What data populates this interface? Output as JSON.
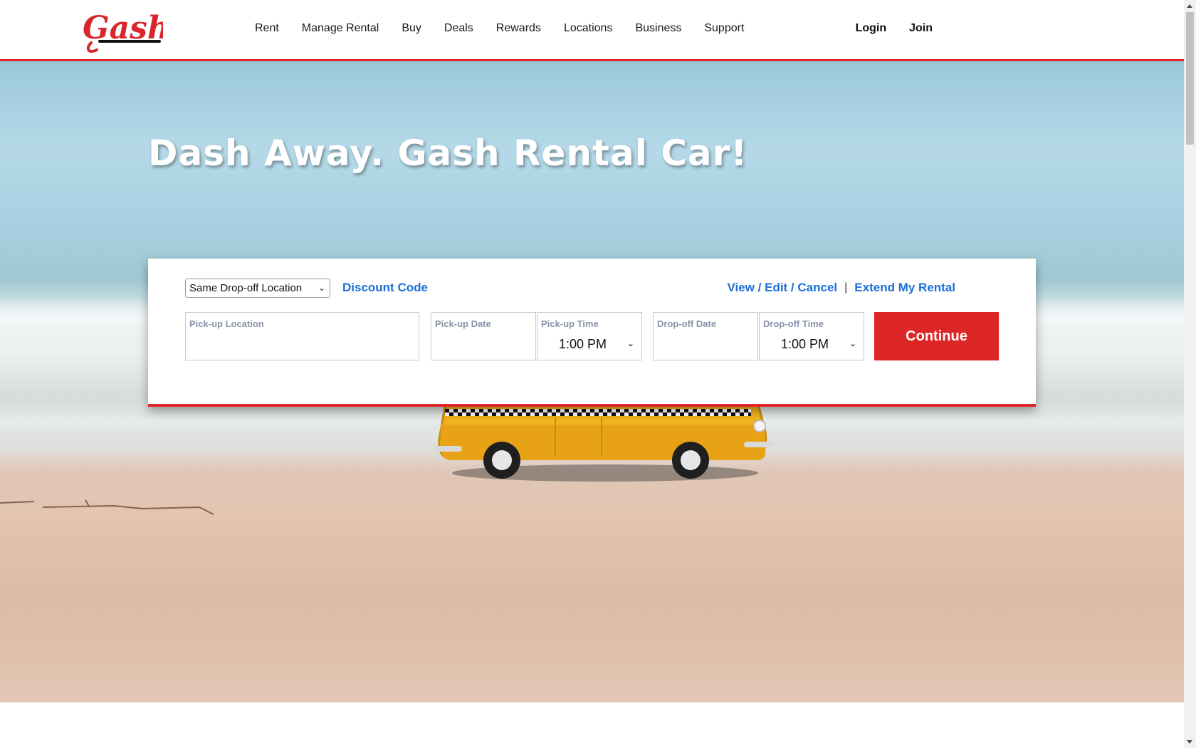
{
  "brand": {
    "logo_text": "Gash",
    "accent_color": "#e0262c",
    "link_color": "#1a6fd6"
  },
  "nav": {
    "items": [
      {
        "label": "Rent"
      },
      {
        "label": "Manage Rental"
      },
      {
        "label": "Buy"
      },
      {
        "label": "Deals"
      },
      {
        "label": "Rewards"
      },
      {
        "label": "Locations"
      },
      {
        "label": "Business"
      },
      {
        "label": "Support"
      }
    ],
    "login_label": "Login",
    "join_label": "Join"
  },
  "hero": {
    "title": "Dash Away. Gash Rental Car!"
  },
  "booking": {
    "location_mode": {
      "selected": "Same Drop-off Location"
    },
    "discount_link": "Discount Code",
    "view_edit_cancel_link": "View / Edit / Cancel",
    "separator": "|",
    "extend_link": "Extend My Rental",
    "pickup_location": {
      "label": "Pick-up Location",
      "value": ""
    },
    "pickup_date": {
      "label": "Pick-up Date",
      "value": ""
    },
    "pickup_time": {
      "label": "Pick-up Time",
      "value": "1:00 PM"
    },
    "dropoff_date": {
      "label": "Drop-off Date",
      "value": ""
    },
    "dropoff_time": {
      "label": "Drop-off Time",
      "value": "1:00 PM"
    },
    "continue_label": "Continue"
  }
}
